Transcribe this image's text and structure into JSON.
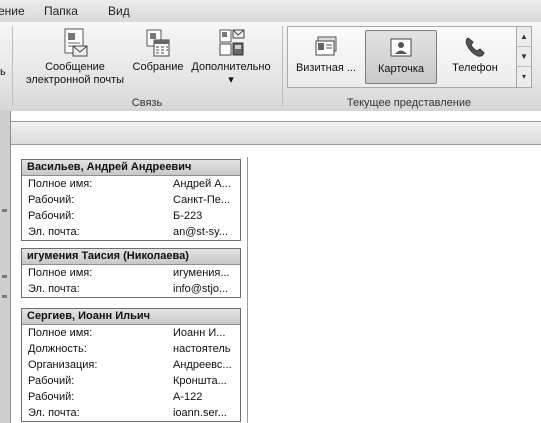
{
  "menu": [
    "ение",
    "Папка",
    "Вид"
  ],
  "ribbon": {
    "left_stub": "ь",
    "group_communicate": {
      "title": "Связь",
      "email_label_1": "Сообщение",
      "email_label_2": "электронной почты",
      "meeting_label": "Собрание",
      "more_label": "Дополнительно",
      "more_arrow": "▾"
    },
    "group_view": {
      "title": "Текущее представление",
      "items": [
        "Визитная ...",
        "Карточка",
        "Телефон"
      ],
      "selected": "Карточка",
      "scroll_up": "▲",
      "scroll_down": "▼",
      "scroll_more": "▾"
    }
  },
  "cards": [
    {
      "name": "Васильев, Андрей Андреевич",
      "fields": [
        {
          "label": "Полное имя:",
          "value": "Андрей А..."
        },
        {
          "label": "Рабочий:",
          "value": "Санкт-Пе..."
        },
        {
          "label": "Рабочий:",
          "value": "Б-223"
        },
        {
          "label": "Эл. почта:",
          "value": "an@st-sy..."
        }
      ]
    },
    {
      "name": "игумения Таисия (Николаева)",
      "fields": [
        {
          "label": "Полное имя:",
          "value": "игумения..."
        },
        {
          "label": "Эл. почта:",
          "value": "info@stjo..."
        }
      ]
    },
    {
      "name": "Сергиев, Иоанн Ильич",
      "fields": [
        {
          "label": "Полное имя:",
          "value": "Иоанн И..."
        },
        {
          "label": "Должность:",
          "value": "настоятель"
        },
        {
          "label": "Организация:",
          "value": "Андреевс..."
        },
        {
          "label": "Рабочий:",
          "value": "Кроншта..."
        },
        {
          "label": "Рабочий:",
          "value": "А-122"
        },
        {
          "label": "Эл. почта:",
          "value": "ioann.ser..."
        }
      ]
    }
  ]
}
